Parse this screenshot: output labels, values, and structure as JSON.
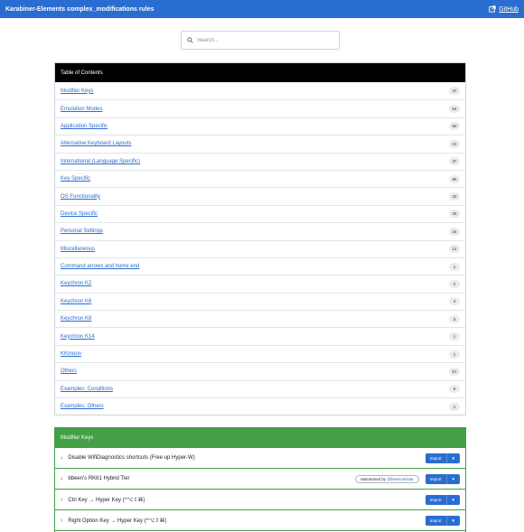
{
  "navbar": {
    "title": "Karabiner-Elements complex_modifications rules",
    "github_label": "GitHub",
    "github_icon": "external-link-icon"
  },
  "search": {
    "placeholder": "Search...",
    "value": ""
  },
  "toc": {
    "header": "Table of Contents",
    "items": [
      {
        "label": "Modifier Keys",
        "count": "47"
      },
      {
        "label": "Emulation Modes",
        "count": "64"
      },
      {
        "label": "Application Specific",
        "count": "58"
      },
      {
        "label": "Alternative Keyboard Layouts",
        "count": "21"
      },
      {
        "label": "International (Language Specific)",
        "count": "37"
      },
      {
        "label": "Key Specific",
        "count": "86"
      },
      {
        "label": "OS Functionality",
        "count": "33"
      },
      {
        "label": "Device Specific",
        "count": "25"
      },
      {
        "label": "Personal Settings",
        "count": "34"
      },
      {
        "label": "Miscellaneous",
        "count": "12"
      },
      {
        "label": "Command arrows and home end",
        "count": "1"
      },
      {
        "label": "Keychron K2",
        "count": "2"
      },
      {
        "label": "Keychron K6",
        "count": "4"
      },
      {
        "label": "Keychron K8",
        "count": "3"
      },
      {
        "label": "Keychron K14",
        "count": "1"
      },
      {
        "label": "KKmoon",
        "count": "1"
      },
      {
        "label": "Others",
        "count": "57"
      },
      {
        "label": "Examples: Conditions",
        "count": "5"
      },
      {
        "label": "Examples: Others",
        "count": "1"
      }
    ]
  },
  "section": {
    "header": "Modifier Keys",
    "import_label": "Import",
    "rules": [
      {
        "title": "Disable WifiDiagnostics shortcuts (Free up Hyper-W)"
      },
      {
        "title": "bbeen's RK61 Hybrid Tier",
        "maintained_prefix": "Maintained by ",
        "maintained_by": "@beerministar"
      },
      {
        "title": "Ctrl Key → Hyper Key (^⌥⇧⌘)"
      },
      {
        "title": "Right Option Key → Hyper Key (^⌥⇧⌘)"
      }
    ]
  },
  "colors": {
    "navbar": "#2a6dd0",
    "toc_header": "#000000",
    "section_header": "#43a047",
    "link": "#2a6dd0"
  }
}
